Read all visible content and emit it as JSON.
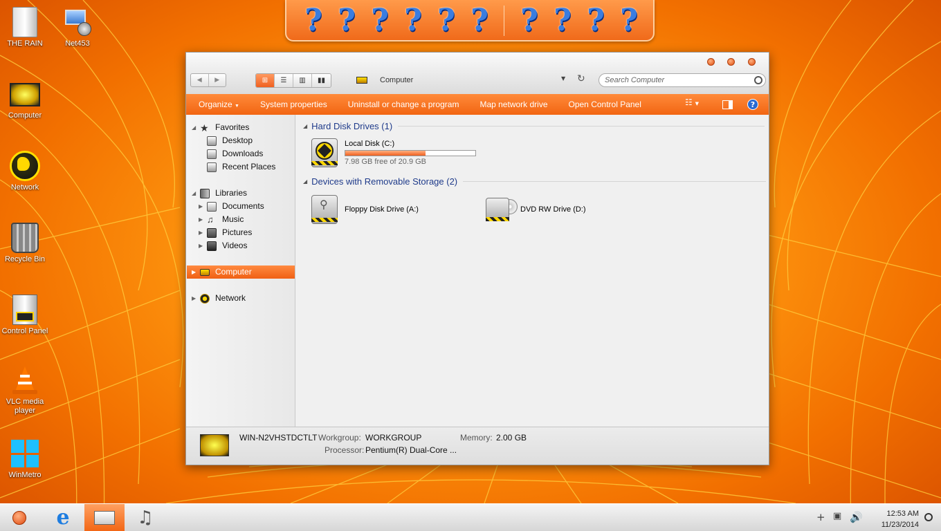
{
  "desktop": {
    "icons": [
      {
        "label": "THE RAIN",
        "icon": "drive-icon"
      },
      {
        "label": "Net453",
        "icon": "network-computer-icon"
      },
      {
        "label": "Computer",
        "icon": "computer-icon"
      },
      {
        "label": "Network",
        "icon": "globe-icon"
      },
      {
        "label": "Recycle Bin",
        "icon": "recycle-bin-icon"
      },
      {
        "label": "Control Panel",
        "icon": "control-panel-icon"
      },
      {
        "label": "VLC media player",
        "icon": "vlc-cone-icon"
      },
      {
        "label": "WinMetro",
        "icon": "windows-logo-icon"
      }
    ]
  },
  "dock": {
    "items": [
      "?",
      "?",
      "?",
      "?",
      "?",
      "?",
      "?",
      "?",
      "?",
      "?"
    ]
  },
  "window": {
    "address": "Computer",
    "search_placeholder": "Search Computer",
    "commands": [
      "Organize",
      "System properties",
      "Uninstall or change a program",
      "Map network drive",
      "Open Control Panel"
    ],
    "help": "?",
    "nav": {
      "favorites": "Favorites",
      "desktop": "Desktop",
      "downloads": "Downloads",
      "recent": "Recent Places",
      "libraries": "Libraries",
      "documents": "Documents",
      "music": "Music",
      "pictures": "Pictures",
      "videos": "Videos",
      "computer": "Computer",
      "network": "Network"
    },
    "groups": {
      "hdd": "Hard Disk Drives (1)",
      "removable": "Devices with Removable Storage (2)"
    },
    "drives": {
      "c": {
        "name": "Local Disk (C:)",
        "free": "7.98 GB free of 20.9 GB",
        "used_fraction": 0.618
      },
      "a": {
        "name": "Floppy Disk Drive (A:)"
      },
      "d": {
        "name": "DVD RW Drive (D:)"
      }
    },
    "details": {
      "computer_name": "WIN-N2VHSTDCTLT",
      "workgroup_label": "Workgroup:",
      "workgroup": "WORKGROUP",
      "memory_label": "Memory:",
      "memory": "2.00 GB",
      "processor_label": "Processor:",
      "processor": "Pentium(R) Dual-Core  ..."
    }
  },
  "taskbar": {
    "time": "12:53 AM",
    "date": "11/23/2014"
  },
  "colors": {
    "accent": "#f26514",
    "desktop": "#ff8c10",
    "link": "#1e3a8a"
  }
}
